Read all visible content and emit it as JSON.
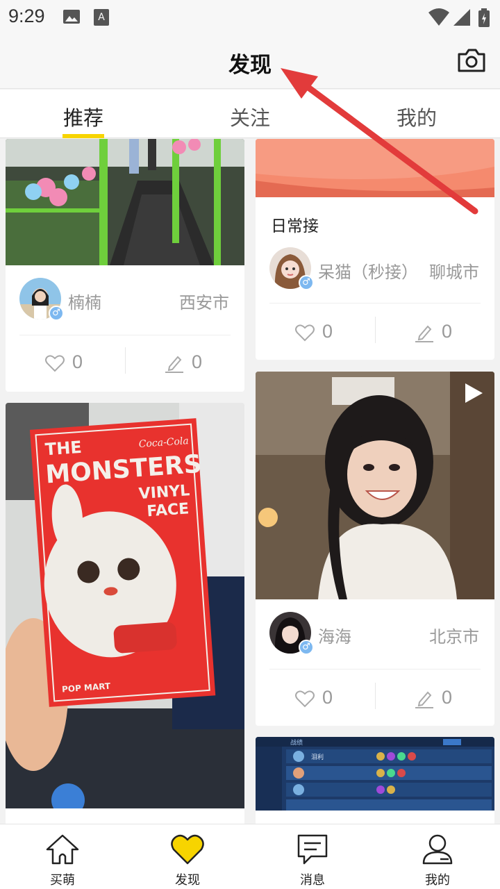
{
  "status_bar": {
    "time": "9:29"
  },
  "header": {
    "title": "发现"
  },
  "tabs": [
    {
      "label": "推荐",
      "active": true
    },
    {
      "label": "关注",
      "active": false
    },
    {
      "label": "我的",
      "active": false
    }
  ],
  "feed": {
    "cards": [
      {
        "user": "楠楠",
        "city": "西安市",
        "likes": "0",
        "comments": "0"
      },
      {
        "caption": "日常接",
        "user": "呆猫（秒接）",
        "city": "聊城市",
        "likes": "0",
        "comments": "0"
      },
      {
        "user": "海海",
        "city": "北京市",
        "likes": "0",
        "comments": "0",
        "is_video": true
      },
      {
        "image_text": {
          "line1": "THE",
          "line2": "MONSTERS",
          "line3": "VINYL",
          "line4": "FACE",
          "brand": "Coca-Cola",
          "maker": "POP MART"
        }
      },
      {
        "image_text": {
          "title": "战绩",
          "name": "泪利"
        }
      }
    ]
  },
  "bottom_nav": [
    {
      "label": "买萌",
      "icon": "home-icon"
    },
    {
      "label": "发现",
      "icon": "heart-icon",
      "active": true
    },
    {
      "label": "消息",
      "icon": "message-icon"
    },
    {
      "label": "我的",
      "icon": "profile-icon"
    }
  ],
  "colors": {
    "accent": "#f7d400",
    "arrow": "#e23b3b",
    "muted": "#999999"
  }
}
